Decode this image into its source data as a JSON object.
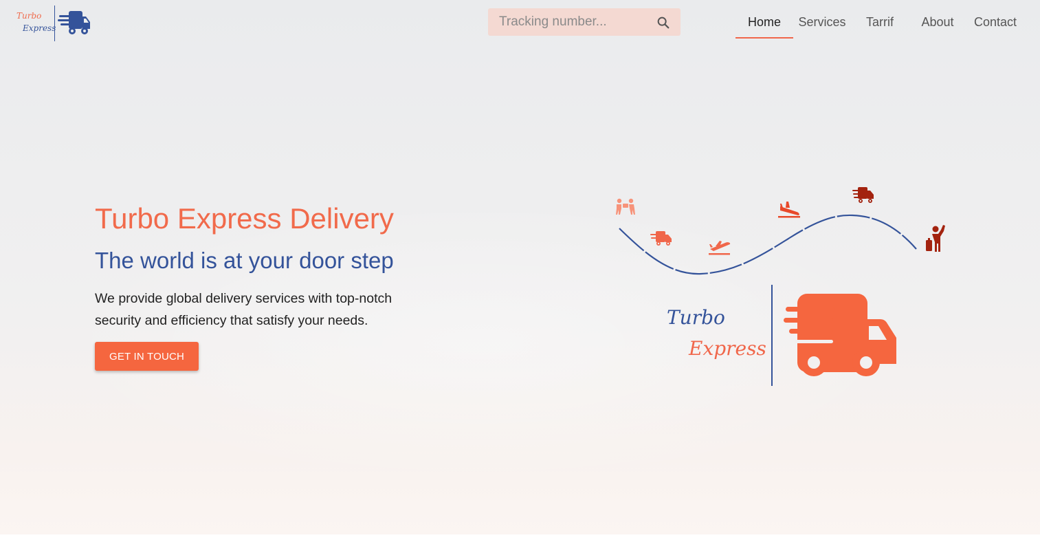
{
  "brand": {
    "name_line1": "Turbo",
    "name_line2": "Express"
  },
  "search": {
    "placeholder": "Tracking number..."
  },
  "nav": {
    "items": [
      {
        "label": "Home",
        "active": true
      },
      {
        "label": "Services"
      },
      {
        "label": "Tarrif"
      },
      {
        "label": "About"
      },
      {
        "label": "Contact"
      }
    ]
  },
  "hero": {
    "title": "Turbo Express Delivery",
    "subtitle": "The world is at your door step",
    "description": "We provide global delivery services with top-notch security and efficiency that satisfy your needs.",
    "cta_label": "GET IN TOUCH"
  },
  "illustration": {
    "word1": "Turbo",
    "word2": "Express",
    "icons": [
      "handshake-icon",
      "delivery-truck-icon",
      "plane-takeoff-icon",
      "plane-landing-icon",
      "delivery-truck-icon",
      "waving-person-icon"
    ]
  },
  "colors": {
    "accent": "#f0664a",
    "brand_blue": "#34539a",
    "dark_red": "#a3230f"
  }
}
